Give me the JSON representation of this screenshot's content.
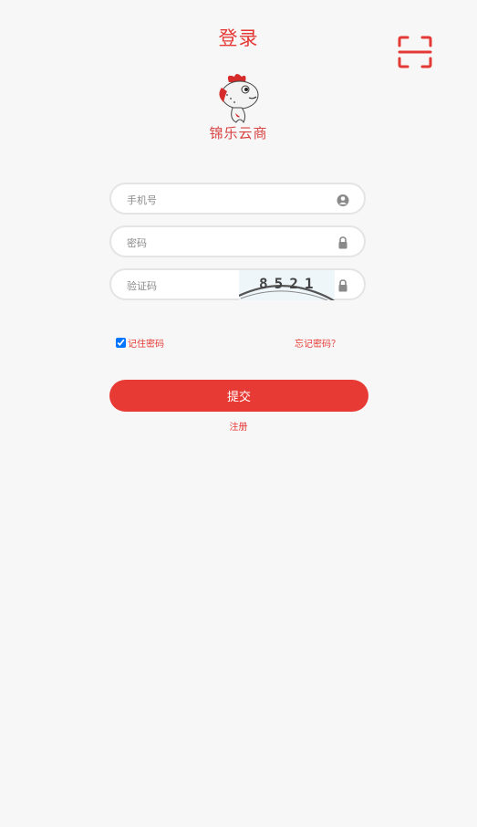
{
  "header": {
    "title": "登录",
    "scan_icon": "scan-frame-icon"
  },
  "brand": {
    "name": "锦乐云商",
    "logo_icon": "fish-mascot-icon"
  },
  "form": {
    "phone": {
      "placeholder": "手机号",
      "value": "",
      "icon": "user-circle-icon"
    },
    "password": {
      "placeholder": "密码",
      "value": "",
      "icon": "lock-icon"
    },
    "captcha": {
      "placeholder": "验证码",
      "value": "",
      "image_text": "8521",
      "icon": "lock-icon"
    },
    "remember_label": "记住密码",
    "remember_checked": true,
    "forgot_label": "忘记密码？",
    "submit_label": "提交",
    "register_label": "注册"
  },
  "colors": {
    "accent": "#e53935",
    "background": "#f7f7f7",
    "field_border": "#e4e4e4",
    "icon_gray": "#8a8a8a"
  }
}
